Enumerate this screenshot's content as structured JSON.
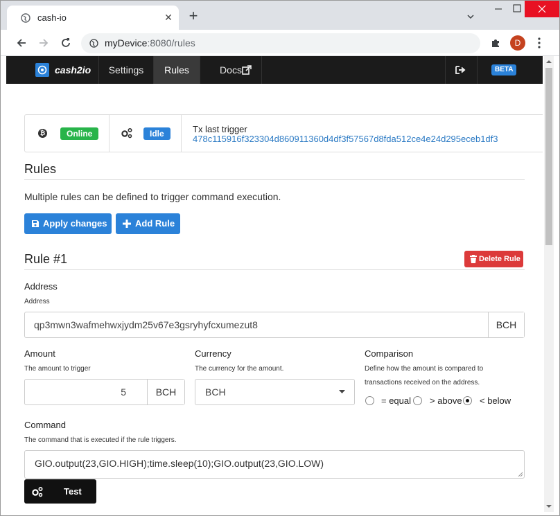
{
  "browser": {
    "tab_title": "cash-io",
    "url_host": "myDevice",
    "url_rest": ":8080/rules",
    "profile_initial": "D"
  },
  "navbar": {
    "brand": "cash2io",
    "items": [
      {
        "label": "Settings",
        "active": false
      },
      {
        "label": "Rules",
        "active": true
      },
      {
        "label": "Docs",
        "active": false
      }
    ],
    "beta_label": "BETA"
  },
  "status": {
    "connection": "Online",
    "state": "Idle",
    "tx_label": "Tx last trigger",
    "tx_hash": "478c115916f323304d860911360d4df3f57567d8fda512ce4e24d295eceb1df3"
  },
  "rules_section": {
    "title": "Rules",
    "intro": "Multiple rules can be defined to trigger command execution.",
    "apply_label": "Apply changes",
    "add_label": "Add Rule"
  },
  "rule": {
    "title": "Rule #1",
    "delete_label": "Delete Rule",
    "address": {
      "label": "Address",
      "help": "Address",
      "value": "qp3mwn3wafmehwxjydm25v67e3gsryhyfcxumezut8",
      "addon": "BCH"
    },
    "amount": {
      "label": "Amount",
      "help": "The amount to trigger",
      "value": "5",
      "addon": "BCH"
    },
    "currency": {
      "label": "Currency",
      "help": "The currency for the amount.",
      "selected": "BCH"
    },
    "comparison": {
      "label": "Comparison",
      "help_line1": "Define how the amount is compared to",
      "help_line2": "transactions received on the address.",
      "options": [
        {
          "label": "= equal",
          "checked": false
        },
        {
          "label": "> above",
          "checked": false
        },
        {
          "label": "< below",
          "checked": true
        }
      ]
    },
    "command": {
      "label": "Command",
      "help": "The command that is executed if the rule triggers.",
      "value": "GIO.output(23,GIO.HIGH);time.sleep(10);GIO.output(23,GIO.LOW)"
    },
    "test_label": "Test"
  },
  "colors": {
    "primary": "#2b82d9",
    "success": "#28b44a",
    "danger": "#dc3a3a",
    "navbar": "#1b1b1b"
  }
}
